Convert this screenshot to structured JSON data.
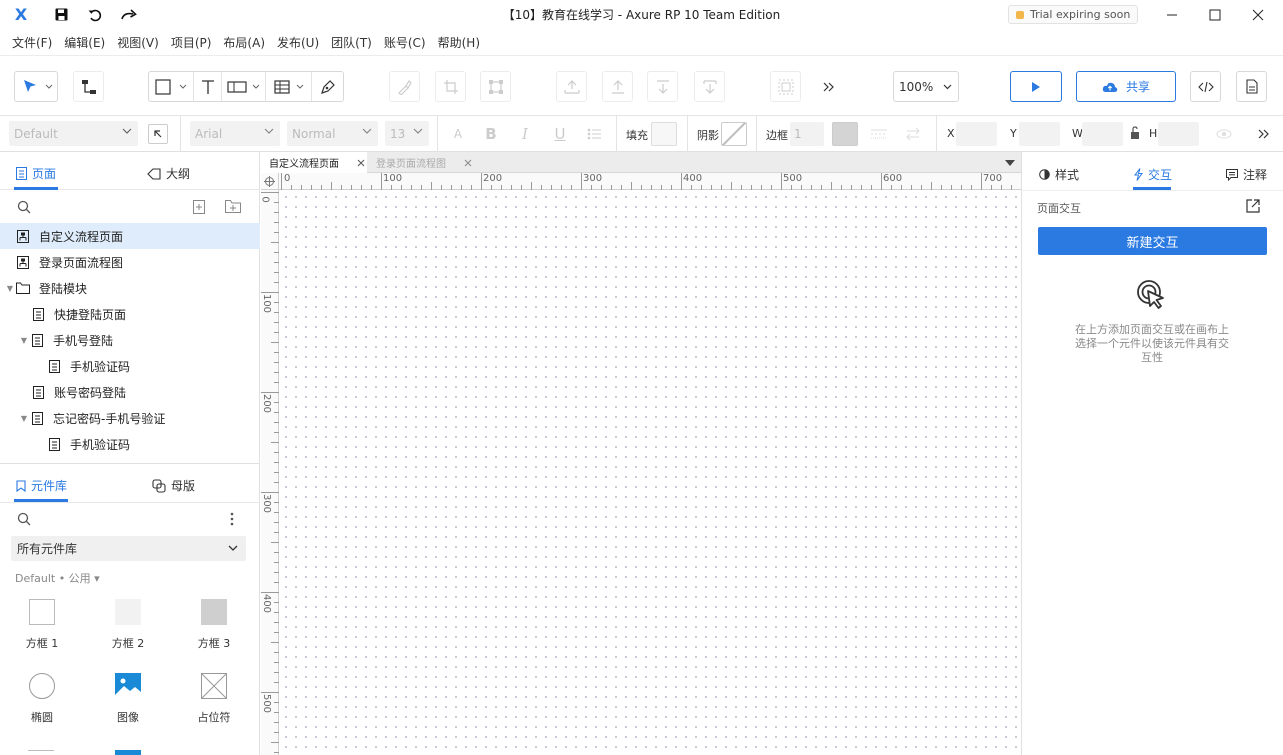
{
  "app": {
    "title": "【10】教育在线学习 - Axure RP 10 Team Edition",
    "logo_glyph": "X",
    "trial_badge": "Trial expiring soon"
  },
  "menu": [
    "文件(F)",
    "编辑(E)",
    "视图(V)",
    "项目(P)",
    "布局(A)",
    "发布(U)",
    "团队(T)",
    "账号(C)",
    "帮助(H)"
  ],
  "toolbar": {
    "zoom": "100%",
    "share_label": "共享"
  },
  "formatbar": {
    "style_select": "Default",
    "font_select": "Arial",
    "weight_select": "Normal",
    "size_select": "13",
    "fill_label": "填充",
    "shadow_label": "阴影",
    "border_label": "边框",
    "border_value": "1",
    "x_label": "X",
    "y_label": "Y",
    "w_label": "W",
    "h_label": "H"
  },
  "left_panel": {
    "tab_pages": "页面",
    "tab_outline": "大纲",
    "pages": [
      {
        "label": "自定义流程页面",
        "type": "flow",
        "selected": true
      },
      {
        "label": "登录页面流程图",
        "type": "flow"
      },
      {
        "label": "登陆模块",
        "type": "folder"
      },
      {
        "label": "快捷登陆页面",
        "type": "page"
      },
      {
        "label": "手机号登陆",
        "type": "page"
      },
      {
        "label": "手机验证码",
        "type": "page"
      },
      {
        "label": "账号密码登陆",
        "type": "page"
      },
      {
        "label": "忘记密码-手机号验证",
        "type": "page"
      },
      {
        "label": "手机验证码",
        "type": "page"
      }
    ],
    "tab_library": "元件库",
    "tab_masters": "母版",
    "library_select": "所有元件库",
    "library_sub": "Default • 公用 ▾",
    "widgets": [
      "方框 1",
      "方框 2",
      "方框 3",
      "椭圆",
      "图像",
      "占位符"
    ]
  },
  "canvas": {
    "tabs": [
      "自定义流程页面",
      "登录页面流程图"
    ],
    "ruler_h": [
      "0",
      "100",
      "200",
      "300",
      "400",
      "500",
      "600",
      "700"
    ],
    "ruler_v": [
      "0",
      "100",
      "200",
      "300",
      "400",
      "500"
    ]
  },
  "right_panel": {
    "tab_style": "样式",
    "tab_interact": "交互",
    "tab_notes": "注释",
    "section_label": "页面交互",
    "new_button": "新建交互",
    "hint": "在上方添加页面交互或在画布上选择一个元件以使该元件具有交互性"
  },
  "colors": {
    "accent": "#2a7ae2",
    "selected_row": "#deecfb",
    "trial_dot": "#f2b64a"
  }
}
